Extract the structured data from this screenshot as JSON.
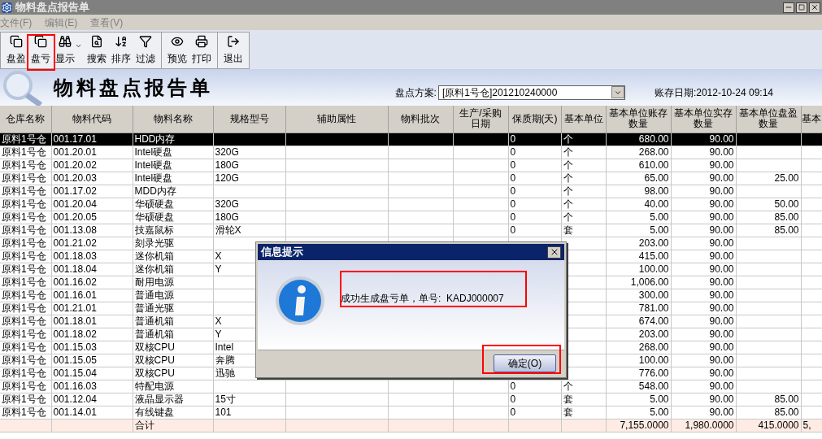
{
  "window": {
    "title": "物料盘点报告单"
  },
  "menu": [
    {
      "label": "文件(F)",
      "disabled": true
    },
    {
      "label": "编辑(E)",
      "disabled": true
    },
    {
      "label": "查看(V)",
      "disabled": true
    }
  ],
  "toolbar": [
    [
      {
        "label": "盘盈",
        "kind": "button"
      },
      {
        "label": "盘亏",
        "kind": "button"
      },
      {
        "label": "显示",
        "kind": "dropdown"
      },
      {
        "label": "搜索",
        "kind": "button"
      },
      {
        "label": "排序",
        "kind": "button"
      },
      {
        "label": "过滤",
        "kind": "button"
      }
    ],
    [
      {
        "label": "预览",
        "kind": "button"
      },
      {
        "label": "打印",
        "kind": "button"
      }
    ],
    [
      {
        "label": "退出",
        "kind": "button"
      }
    ]
  ],
  "header": {
    "title": "物料盘点报告单",
    "plan_label": "盘点方案:",
    "plan_value": "[原料1号仓]201210240000",
    "date": "账存日期:2012-10-24 09:14"
  },
  "table": {
    "columns": [
      "仓库名称",
      "物料代码",
      "物料名称",
      "规格型号",
      "辅助属性",
      "物料批次",
      "生产/采购日期",
      "保质期(天)",
      "基本单位",
      "基本单位账存数量",
      "基本单位实存数量",
      "基本单位盘盈数量",
      "基本"
    ],
    "rows": [
      {
        "selected": true,
        "warehouse": "原料1号仓",
        "code": "001.17.01",
        "name": "HDD内存",
        "shelf_life": "0",
        "unit": "个",
        "book_qty": "680.00",
        "actual_qty": "90.00"
      },
      {
        "selected": false,
        "warehouse": "原料1号仓",
        "code": "001.20.01",
        "name": "Intel硬盘",
        "spec": "320G",
        "shelf_life": "0",
        "unit": "个",
        "book_qty": "268.00",
        "actual_qty": "90.00"
      },
      {
        "selected": false,
        "warehouse": "原料1号仓",
        "code": "001.20.02",
        "name": "Intel硬盘",
        "spec": "180G",
        "shelf_life": "0",
        "unit": "个",
        "book_qty": "610.00",
        "actual_qty": "90.00"
      },
      {
        "selected": false,
        "warehouse": "原料1号仓",
        "code": "001.20.03",
        "name": "Intel硬盘",
        "spec": "120G",
        "shelf_life": "0",
        "unit": "个",
        "book_qty": "65.00",
        "actual_qty": "90.00",
        "gain_qty": "25.00"
      },
      {
        "selected": false,
        "warehouse": "原料1号仓",
        "code": "001.17.02",
        "name": "MDD内存",
        "shelf_life": "0",
        "unit": "个",
        "book_qty": "98.00",
        "actual_qty": "90.00"
      },
      {
        "selected": false,
        "warehouse": "原料1号仓",
        "code": "001.20.04",
        "name": "华硕硬盘",
        "spec": "320G",
        "shelf_life": "0",
        "unit": "个",
        "book_qty": "40.00",
        "actual_qty": "90.00",
        "gain_qty": "50.00"
      },
      {
        "selected": false,
        "warehouse": "原料1号仓",
        "code": "001.20.05",
        "name": "华硕硬盘",
        "spec": "180G",
        "shelf_life": "0",
        "unit": "个",
        "book_qty": "5.00",
        "actual_qty": "90.00",
        "gain_qty": "85.00"
      },
      {
        "selected": false,
        "warehouse": "原料1号仓",
        "code": "001.13.08",
        "name": "技嘉鼠标",
        "spec": "滑轮X",
        "shelf_life": "0",
        "unit": "套",
        "book_qty": "5.00",
        "actual_qty": "90.00",
        "gain_qty": "85.00"
      },
      {
        "selected": false,
        "warehouse": "原料1号仓",
        "code": "001.21.02",
        "name": "刻录光驱",
        "book_qty": "203.00",
        "actual_qty": "90.00"
      },
      {
        "selected": false,
        "warehouse": "原料1号仓",
        "code": "001.18.03",
        "name": "迷你机箱",
        "spec": "X",
        "book_qty": "415.00",
        "actual_qty": "90.00"
      },
      {
        "selected": false,
        "warehouse": "原料1号仓",
        "code": "001.18.04",
        "name": "迷你机箱",
        "spec": "Y",
        "book_qty": "100.00",
        "actual_qty": "90.00"
      },
      {
        "selected": false,
        "warehouse": "原料1号仓",
        "code": "001.16.02",
        "name": "耐用电源",
        "book_qty": "1,006.00",
        "actual_qty": "90.00"
      },
      {
        "selected": false,
        "warehouse": "原料1号仓",
        "code": "001.16.01",
        "name": "普通电源",
        "book_qty": "300.00",
        "actual_qty": "90.00"
      },
      {
        "selected": false,
        "warehouse": "原料1号仓",
        "code": "001.21.01",
        "name": "普通光驱",
        "book_qty": "781.00",
        "actual_qty": "90.00"
      },
      {
        "selected": false,
        "warehouse": "原料1号仓",
        "code": "001.18.01",
        "name": "普通机箱",
        "spec": "X",
        "book_qty": "674.00",
        "actual_qty": "90.00"
      },
      {
        "selected": false,
        "warehouse": "原料1号仓",
        "code": "001.18.02",
        "name": "普通机箱",
        "spec": "Y",
        "book_qty": "203.00",
        "actual_qty": "90.00"
      },
      {
        "selected": false,
        "warehouse": "原料1号仓",
        "code": "001.15.03",
        "name": "双核CPU",
        "spec": "Intel",
        "book_qty": "268.00",
        "actual_qty": "90.00"
      },
      {
        "selected": false,
        "warehouse": "原料1号仓",
        "code": "001.15.05",
        "name": "双核CPU",
        "spec": "奔腾",
        "book_qty": "100.00",
        "actual_qty": "90.00"
      },
      {
        "selected": false,
        "warehouse": "原料1号仓",
        "code": "001.15.04",
        "name": "双核CPU",
        "spec": "迅驰",
        "book_qty": "776.00",
        "actual_qty": "90.00"
      },
      {
        "selected": false,
        "warehouse": "原料1号仓",
        "code": "001.16.03",
        "name": "特配电源",
        "shelf_life": "0",
        "unit": "个",
        "book_qty": "548.00",
        "actual_qty": "90.00"
      },
      {
        "selected": false,
        "warehouse": "原料1号仓",
        "code": "001.12.04",
        "name": "液晶显示器",
        "spec": "15寸",
        "shelf_life": "0",
        "unit": "套",
        "book_qty": "5.00",
        "actual_qty": "90.00",
        "gain_qty": "85.00"
      },
      {
        "selected": false,
        "warehouse": "原料1号仓",
        "code": "001.14.01",
        "name": "有线键盘",
        "spec": "101",
        "shelf_life": "0",
        "unit": "套",
        "book_qty": "5.00",
        "actual_qty": "90.00",
        "gain_qty": "85.00"
      }
    ],
    "total": {
      "name": "合计",
      "book_qty": "7,155.0000",
      "actual_qty": "1,980.0000",
      "gain_qty": "415.0000",
      "loss_qty": "5,"
    }
  },
  "dialog": {
    "title": "信息提示",
    "message": "成功生成盘亏单，单号:  KADJ000007",
    "button": "确定(O)"
  }
}
